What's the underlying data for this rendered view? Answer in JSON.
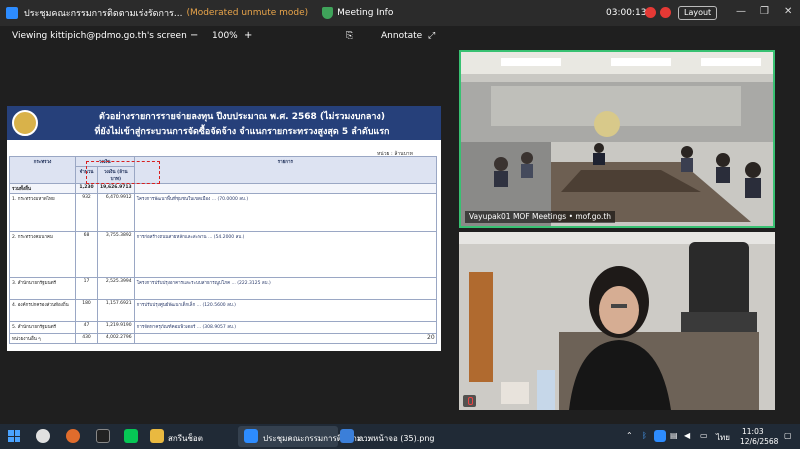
{
  "titlebar": {
    "title": "ประชุมคณะกรรมการติดตามเร่งรัดการ...",
    "moderated": "(Moderated unmute mode)",
    "info": "Meeting Info",
    "timer": "03:00:13",
    "layout": "Layout",
    "minimize": "—",
    "restore": "❐",
    "close": "✕"
  },
  "toolbar": {
    "viewing": "Viewing kittipich@pdmo.go.th's screen",
    "zoom_out": "−",
    "zoom": "100%",
    "zoom_in": "+",
    "annotate": "Annotate"
  },
  "doc": {
    "title1": "ตัวอย่างรายการรายจ่ายลงทุน ปีงบประมาณ พ.ศ. 2568 (ไม่รวมงบกลาง)",
    "title2": "ที่ยังไม่เข้าสู่กระบวนการจัดซื้อจัดจ้าง จำแนกรายกระทรวงสูงสุด 5 ลำดับแรก",
    "unit": "หน่วย : ล้านบาท",
    "headers": [
      "กระทรวง",
      "รายการ",
      "วงเงิน",
      "รายการ"
    ],
    "subheaders": [
      "จำนวน",
      "วงเงิน (ล้านบาท)"
    ],
    "total": {
      "label": "รวมทั้งสิ้น",
      "count": "1,230",
      "amount": "19,626.9713"
    },
    "rows": [
      {
        "name": "1. กระทรวงมหาดไทย",
        "count": "932",
        "amount": "6,470.9912",
        "detail": "โครงการพัฒนาพื้นที่ชุมชนในเขตเมือง ... (70.0000 ลบ.)"
      },
      {
        "name": "2. กระทรวงคมนาคม",
        "count": "68",
        "amount": "3,755.3892",
        "detail": "การก่อสร้างถนนสายหลักและสะพาน ... (54.2000 ลบ.)"
      },
      {
        "name": "3. สำนักนายกรัฐมนตรี",
        "count": "17",
        "amount": "2,525.3994",
        "detail": "โครงการปรับปรุงอาคารและระบบสาธารณูปโภค ... (222.3125 ลบ.)"
      },
      {
        "name": "4. องค์กรปกครองส่วนท้องถิ่น",
        "count": "180",
        "amount": "1,157.6921",
        "detail": "การปรับปรุงศูนย์พัฒนาเด็กเล็ก ... (120.5600 ลบ.)"
      },
      {
        "name": "5. สำนักนายกรัฐมนตรี",
        "count": "47",
        "amount": "1,219.9190",
        "detail": "การจัดหาครุภัณฑ์คอมพิวเตอร์ ... (308.9057 ลบ.)"
      },
      {
        "name": "หน่วยงานอื่น ๆ",
        "count": "430",
        "amount": "4,002.2796",
        "detail": ""
      }
    ],
    "page": "20"
  },
  "videos": [
    {
      "label": "Vayupak01 MOF Meetings • mof.go.th"
    },
    {
      "label": ""
    }
  ],
  "taskbar": {
    "folder": "สกรีนช็อต",
    "active": "ประชุมคณะกรรมการติดตาม...",
    "png": "ภาพหน้าจอ (35).png",
    "lang": "ไทย",
    "time": "11:03",
    "date": "12/6/2568"
  },
  "colors": {
    "accent": "#2d8cff",
    "active_border": "#38c172",
    "doc_header": "#26407a"
  }
}
